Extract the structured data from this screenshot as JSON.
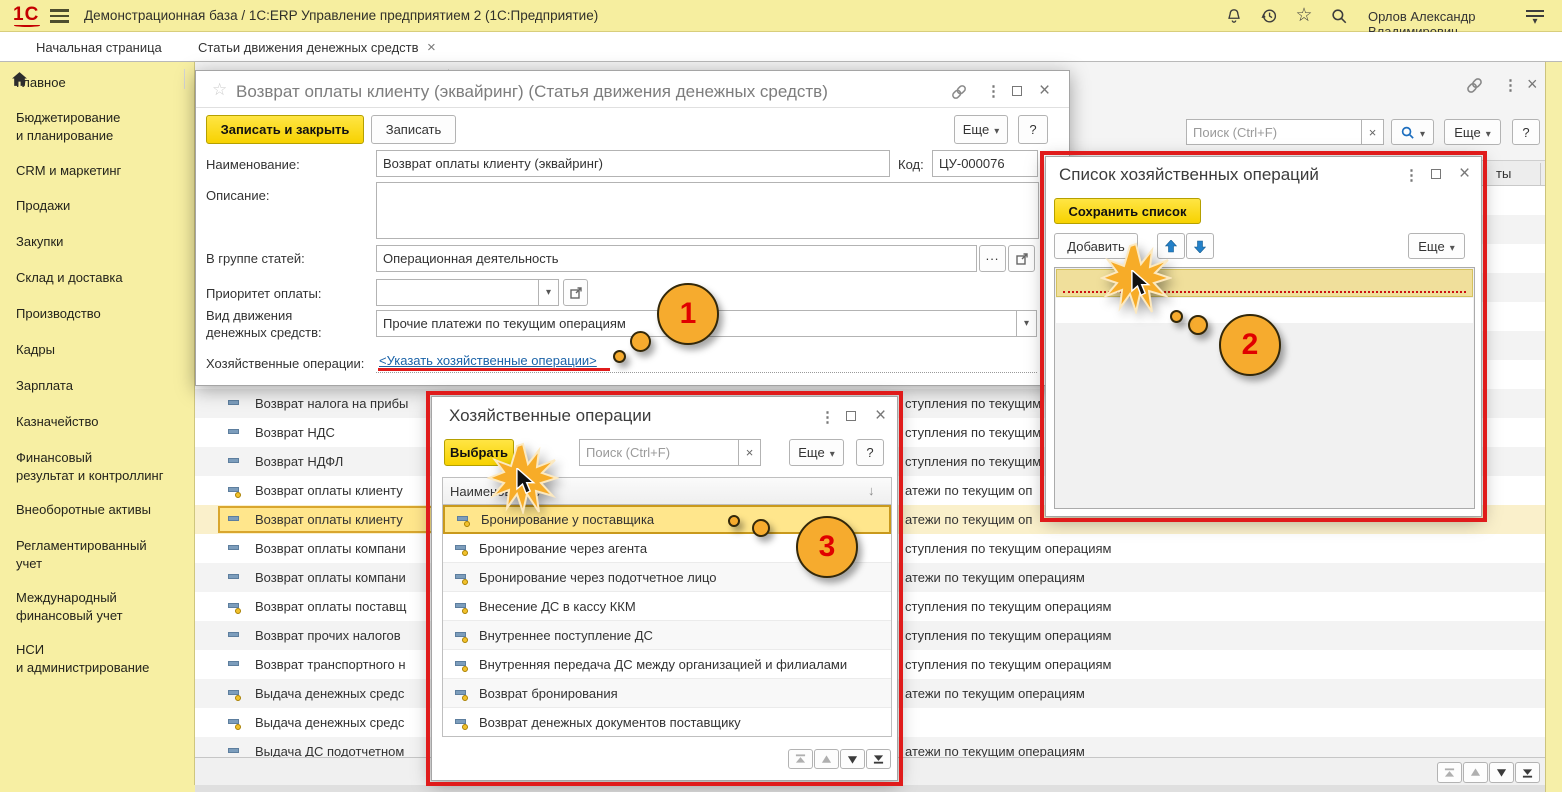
{
  "app": {
    "logo": "1С",
    "title": "Демонстрационная база / 1С:ERP Управление предприятием 2  (1С:Предприятие)",
    "user": "Орлов Александр Владимирович"
  },
  "tabs": {
    "home_label": "Начальная страница",
    "active_label": "Статьи движения денежных средств"
  },
  "sidebar": {
    "items": [
      "Главное",
      "Бюджетирование\nи планирование",
      "CRM и маркетинг",
      "Продажи",
      "Закупки",
      "Склад и доставка",
      "Производство",
      "Кадры",
      "Зарплата",
      "Казначейство",
      "Финансовый\nрезультат и контроллинг",
      "Внеоборотные активы",
      "Регламентированный\nучет",
      "Международный\nфинансовый учет",
      "НСИ\nи администрирование"
    ]
  },
  "background": {
    "search_placeholder": "Поиск (Ctrl+F)",
    "more_label": "Еще",
    "help_label": "?",
    "header_fragment": "ты",
    "rows": [
      {
        "name": "Возврат налога на прибы",
        "type": "ступления по текущим операциям",
        "dot": false,
        "selected": false
      },
      {
        "name": "Возврат НДС",
        "type": "ступления по текущим операциям",
        "dot": false,
        "selected": false
      },
      {
        "name": "Возврат НДФЛ",
        "type": "ступления по текущим операциям",
        "dot": false,
        "selected": false
      },
      {
        "name": "Возврат оплаты клиенту",
        "type": "атежи по текущим оп",
        "dot": true,
        "selected": false
      },
      {
        "name": "Возврат оплаты клиенту",
        "type": "атежи по текущим оп",
        "dot": false,
        "selected": true
      },
      {
        "name": "Возврат оплаты компани",
        "type": "ступления по текущим операциям",
        "dot": false,
        "selected": false
      },
      {
        "name": "Возврат оплаты компани",
        "type": "атежи по текущим операциям",
        "dot": false,
        "selected": false
      },
      {
        "name": "Возврат оплаты поставщ",
        "type": "ступления по текущим операциям",
        "dot": true,
        "selected": false
      },
      {
        "name": "Возврат прочих налогов",
        "type": "ступления по текущим операциям",
        "dot": false,
        "selected": false
      },
      {
        "name": "Возврат транспортного н",
        "type": "ступления по текущим операциям",
        "dot": false,
        "selected": false
      },
      {
        "name": "Выдача денежных средс",
        "type": "атежи по текущим операциям",
        "dot": true,
        "selected": false
      },
      {
        "name": "Выдача денежных средс",
        "type": "",
        "dot": true,
        "selected": false
      },
      {
        "name": "Выдача ДС подотчетном",
        "type": "атежи по текущим операциям",
        "dot": false,
        "selected": false
      }
    ]
  },
  "main_dialog": {
    "title": "Возврат оплаты клиенту (эквайринг) (Статья движения денежных средств)",
    "save_close_label": "Записать и закрыть",
    "save_label": "Записать",
    "more_label": "Еще",
    "help_label": "?",
    "fields": {
      "name_label": "Наименование:",
      "name_value": "Возврат оплаты клиенту (эквайринг)",
      "code_label": "Код:",
      "code_value": "ЦУ-000076",
      "description_label": "Описание:",
      "group_label": "В группе статей:",
      "group_value": "Операционная деятельность",
      "priority_label": "Приоритет оплаты:",
      "movement_label": "Вид движения\nденежных средств:",
      "movement_value": "Прочие платежи по текущим операциям",
      "operations_label": "Хозяйственные операции:",
      "operations_link": "<Указать хозяйственные операции>"
    }
  },
  "list_dialog": {
    "title": "Список хозяйственных операций",
    "save_list_label": "Сохранить список",
    "add_label": "Добавить",
    "more_label": "Еще"
  },
  "select_dialog": {
    "title": "Хозяйственные операции",
    "choose_label": "Выбрать",
    "search_placeholder": "Поиск (Ctrl+F)",
    "more_label": "Еще",
    "help_label": "?",
    "column_header": "Наименование",
    "rows": [
      "Бронирование у поставщика",
      "Бронирование через агента",
      "Бронирование через подотчетное лицо",
      "Внесение ДС в кассу ККМ",
      "Внутреннее поступление ДС",
      "Внутренняя передача ДС между организацией и филиалами",
      "Возврат бронирования",
      "Возврат денежных документов поставщику"
    ]
  },
  "annotations": {
    "badge1": "1",
    "badge2": "2",
    "badge3": "3"
  },
  "colors": {
    "accent_yellow": "#F7D200",
    "annotation_red": "#E01B1B",
    "badge_orange": "#F6AB2E",
    "link_blue": "#1B63A8",
    "tab_green": "#2CA049",
    "selection_yellow": "#FFE68C"
  }
}
